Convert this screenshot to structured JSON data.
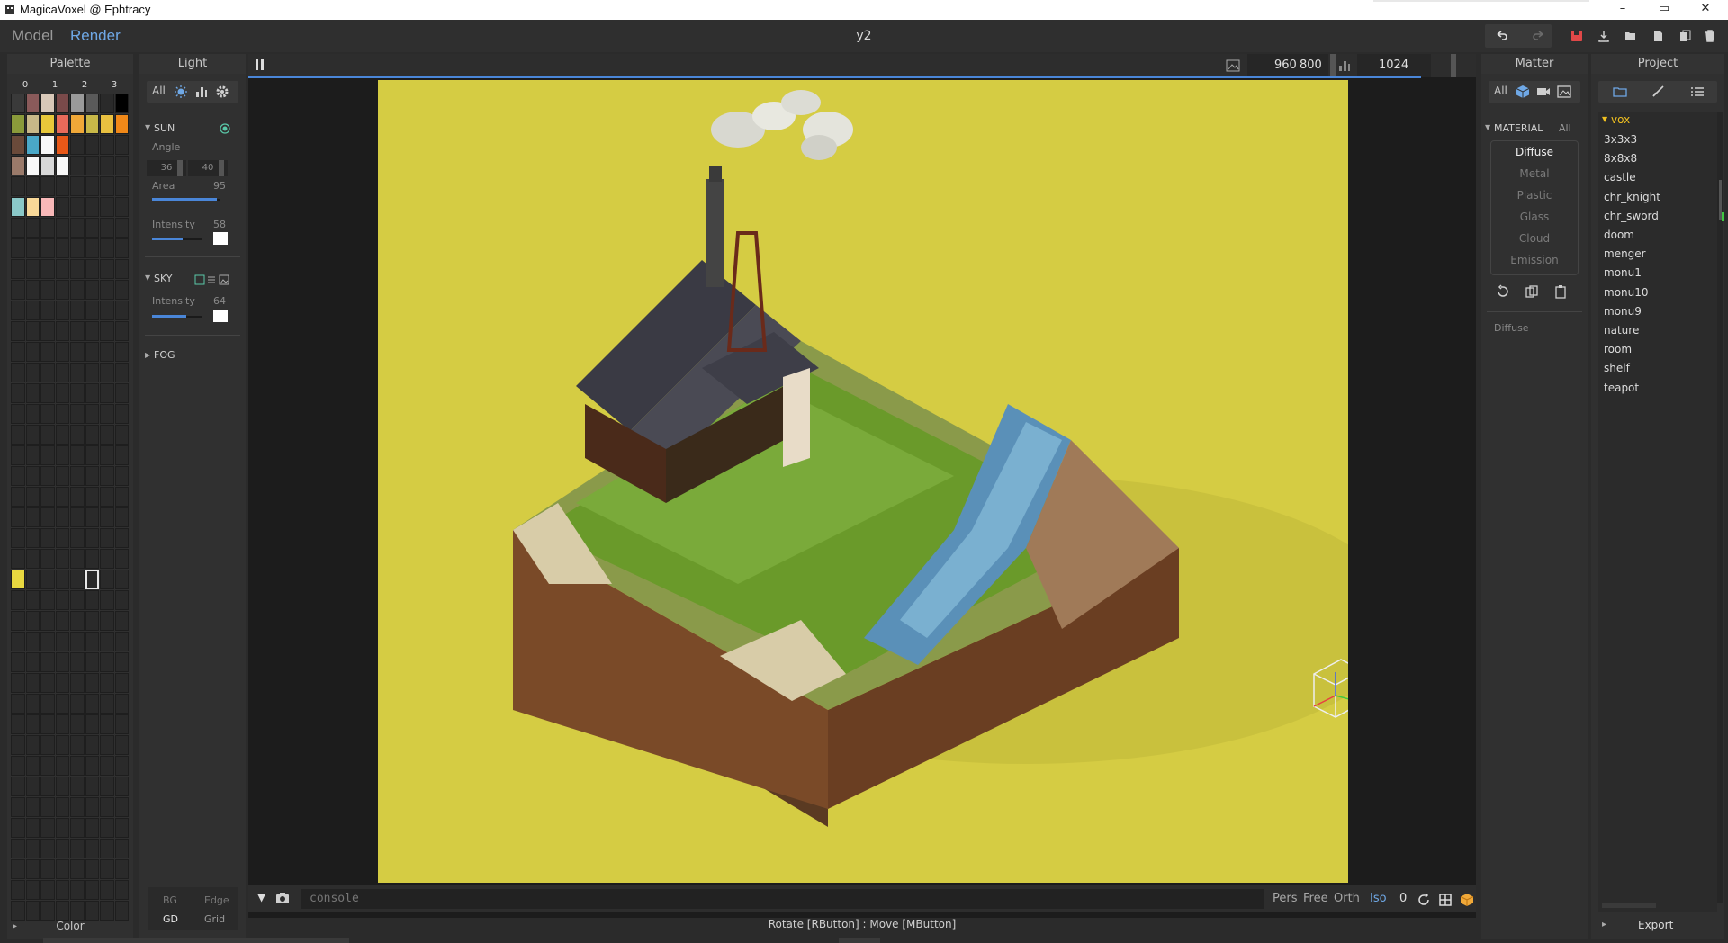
{
  "window": {
    "title": "MagicaVoxel @ Ephtracy"
  },
  "appbar": {
    "mode_model": "Model",
    "mode_render": "Render",
    "doc_title": "y2"
  },
  "palette": {
    "header": "Palette",
    "tabs": [
      "0",
      "1",
      "2",
      "3"
    ],
    "footer": "Color",
    "colors_row1": [
      "#3a3a3a",
      "#8a5a5a",
      "#d8c8b8",
      "#7a4a4a",
      "#9a9a9a",
      "#5a5a5a",
      "#2a2a2a",
      "#000000"
    ],
    "colors_row2": [
      "#8a9a3a",
      "#c8b888",
      "#e8c83a",
      "#e86a5a",
      "#f0a838",
      "#c8b848",
      "#e8c040",
      "#f08818"
    ],
    "colors_row3": [
      "#6a4a3a",
      "#4aa8c8",
      "#f8f8f8",
      "#e85818",
      "#2a2a2a",
      "#2a2a2a",
      "#2a2a2a",
      "#2a2a2a"
    ],
    "colors_row4": [
      "#9a7a6a",
      "#f8f8f8",
      "#d8d8d8",
      "#f8f8f8",
      "#2a2a2a",
      "#2a2a2a",
      "#2a2a2a",
      "#2a2a2a"
    ],
    "colors_row6": [
      "#8ac8c8",
      "#f8d898",
      "#f8b8b8",
      "#2a2a2a",
      "#2a2a2a",
      "#2a2a2a",
      "#2a2a2a",
      "#2a2a2a"
    ],
    "selected_color": "#e8d840"
  },
  "light": {
    "header": "Light",
    "tabs": {
      "all": "All"
    },
    "sun": {
      "label": "SUN",
      "angle_label": "Angle",
      "angle_1": "36",
      "angle_2": "40",
      "area_label": "Area",
      "area_value": "95",
      "intensity_label": "Intensity",
      "intensity_value": "58"
    },
    "sky": {
      "label": "SKY",
      "intensity_label": "Intensity",
      "intensity_value": "64"
    },
    "fog": {
      "label": "FOG"
    },
    "footer": {
      "bg": "BG",
      "edge": "Edge",
      "gd": "GD",
      "grid": "Grid"
    }
  },
  "viewport": {
    "resolution_w": "960",
    "resolution_h": "800",
    "samples": "1024",
    "background_color": "#d5cc43",
    "progress": 0.955
  },
  "console": {
    "placeholder": "console"
  },
  "camera": {
    "pers": "Pers",
    "free": "Free",
    "orth": "Orth",
    "iso": "Iso",
    "zero": "0"
  },
  "status": {
    "text": "Rotate [RButton] : Move [MButton]"
  },
  "matter": {
    "header": "Matter",
    "tab_all": "All",
    "section": "MATERIAL",
    "section_all": "All",
    "items": [
      "Diffuse",
      "Metal",
      "Plastic",
      "Glass",
      "Cloud",
      "Emission"
    ],
    "selected": "Diffuse",
    "current": "Diffuse"
  },
  "project": {
    "header": "Project",
    "folder": "vox",
    "items": [
      "3x3x3",
      "8x8x8",
      "castle",
      "chr_knight",
      "chr_sword",
      "doom",
      "menger",
      "monu1",
      "monu10",
      "monu9",
      "nature",
      "room",
      "shelf",
      "teapot"
    ],
    "footer": "Export"
  }
}
